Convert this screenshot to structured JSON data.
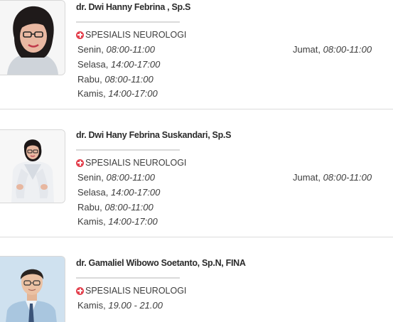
{
  "doctors": [
    {
      "name": "dr. Dwi Hanny Febrina , Sp.S",
      "specialty": "SPESIALIS NEUROLOGI",
      "schedule_left": [
        {
          "day": "Senin,",
          "time": "08:00-11:00"
        },
        {
          "day": "Selasa,",
          "time": "14:00-17:00"
        },
        {
          "day": "Rabu,",
          "time": "08:00-11:00"
        },
        {
          "day": "Kamis,",
          "time": "14:00-17:00"
        }
      ],
      "schedule_right": [
        {
          "day": "Jumat,",
          "time": "08:00-11:00"
        }
      ]
    },
    {
      "name": "dr. Dwi Hany Febrina Suskandari, Sp.S",
      "specialty": "SPESIALIS NEUROLOGI",
      "schedule_left": [
        {
          "day": "Senin,",
          "time": "08:00-11:00"
        },
        {
          "day": "Selasa,",
          "time": "14:00-17:00"
        },
        {
          "day": "Rabu,",
          "time": "08:00-11:00"
        },
        {
          "day": "Kamis,",
          "time": "14:00-17:00"
        }
      ],
      "schedule_right": [
        {
          "day": "Jumat,",
          "time": "08:00-11:00"
        }
      ]
    },
    {
      "name": "dr. Gamaliel Wibowo Soetanto, Sp.N, FINA",
      "specialty": "SPESIALIS NEUROLOGI",
      "schedule_left": [
        {
          "day": "Kamis,",
          "time": "19.00 - 21.00"
        }
      ],
      "schedule_right": []
    }
  ],
  "icons": {
    "specialty": "plus-circle-icon"
  },
  "colors": {
    "accent": "#e3424f",
    "divider": "#dadada",
    "card_border": "#dcdcdc"
  }
}
